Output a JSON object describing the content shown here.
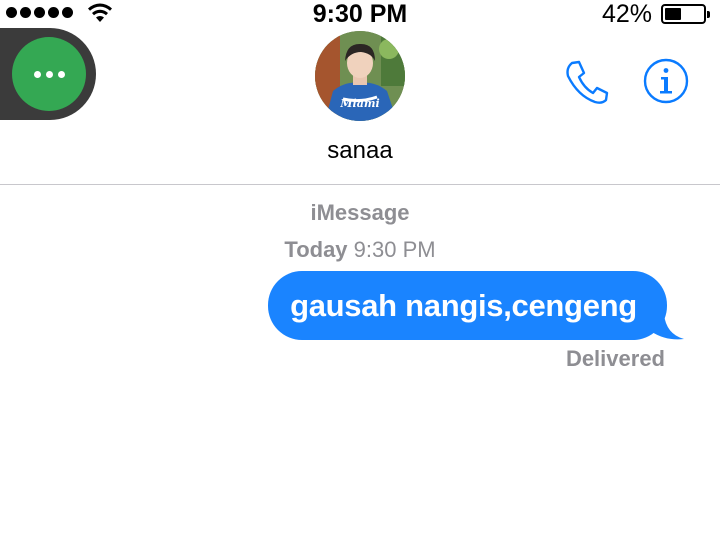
{
  "status_bar": {
    "time": "9:30 PM",
    "battery_percent": "42%",
    "battery_level": 0.42,
    "signal_dots": 5,
    "wifi_icon": "wifi-icon"
  },
  "header": {
    "contact_name": "sanaa",
    "avatar_icon": "contact-avatar-photo",
    "call_icon": "phone-icon",
    "info_icon": "info-icon",
    "assistive_icon": "assistive-touch-icon"
  },
  "conversation": {
    "service": "iMessage",
    "timestamp_day": "Today",
    "timestamp_time": "9:30 PM",
    "messages": [
      {
        "direction": "outgoing",
        "text": "gausah nangis,cengeng",
        "status": "Delivered"
      }
    ]
  },
  "colors": {
    "bubble_blue": "#1a84ff",
    "accent_blue": "#0a7bff",
    "muted_gray": "#8e8e93",
    "assistive_green": "#34a853"
  }
}
